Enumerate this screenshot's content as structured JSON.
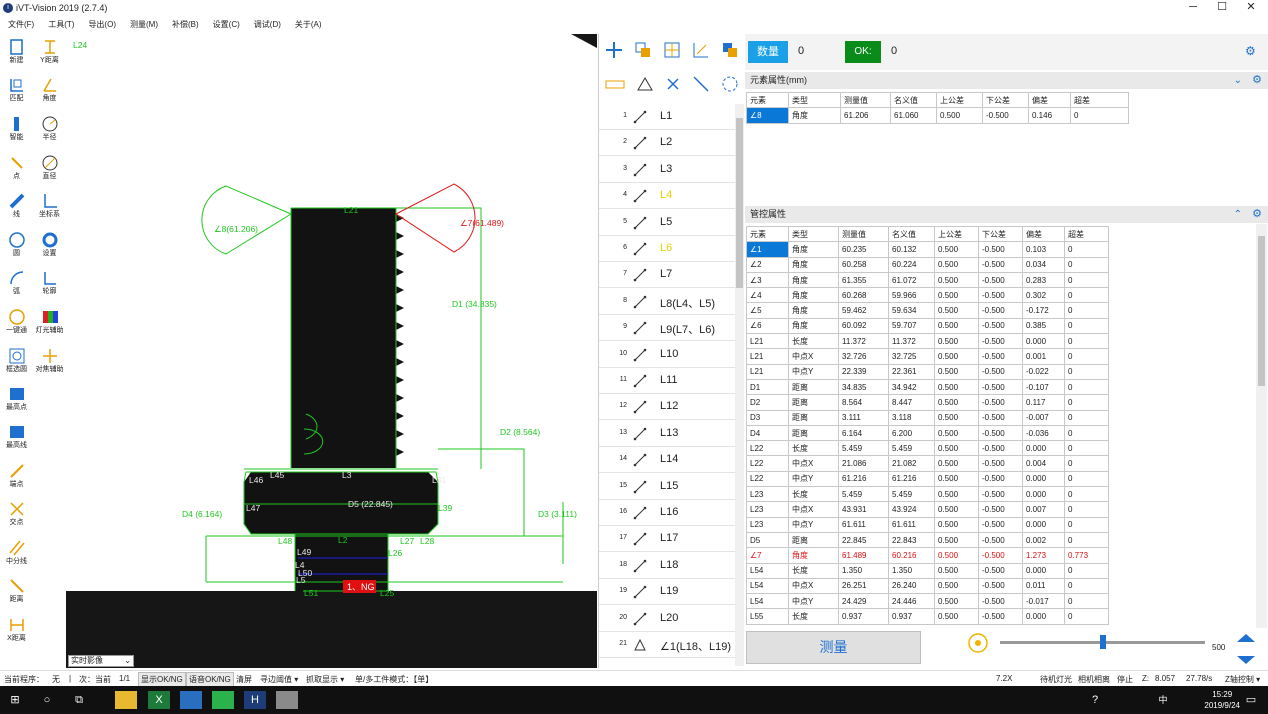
{
  "window": {
    "title": "iVT-Vision 2019  (2.7.4)",
    "minimize": "─",
    "maximize": "☐",
    "close": "✕"
  },
  "menu": [
    "文件(F)",
    "工具(T)",
    "导出(O)",
    "测量(M)",
    "补偿(B)",
    "设置(C)",
    "调试(D)",
    "关于(A)"
  ],
  "lefttools": [
    "新建",
    "Y距离",
    "匹配",
    "角度",
    "智能",
    "半径",
    "点",
    "直径",
    "线",
    "坐标系",
    "圆",
    "设置",
    "弧",
    "轮廓",
    "一键通",
    "灯光辅助",
    "框选圆",
    "对焦辅助",
    "最高点",
    "最高线",
    "端点",
    "交点",
    "中分线",
    "距离",
    "X距离"
  ],
  "viewer": {
    "corner_label": "L24",
    "view_mode": "实时影像",
    "ng_tag": "1、NG",
    "labels": {
      "a8": "∠8(61.206)",
      "a7": "∠7(61.489)",
      "d1": "D1  (34.835)",
      "d2": "D2  (8.564)",
      "d3": "D3  (3.111)",
      "d4": "D4  (6.164)",
      "d5": "D5  (22.845)",
      "l21": "L21",
      "l3": "L3",
      "l2": "L2",
      "l46": "L46",
      "l45": "L45",
      "l47": "L47",
      "l48": "L48",
      "l49": "L49",
      "l51": "L51",
      "l25": "L25",
      "l26": "L26",
      "l27": "L27",
      "l28": "L28",
      "l4": "L4",
      "l5": "L5",
      "l50": "L50",
      "l31": "L31",
      "l39": "L39"
    }
  },
  "midlist": {
    "items": [
      {
        "n": "1",
        "label": "L1"
      },
      {
        "n": "2",
        "label": "L2"
      },
      {
        "n": "3",
        "label": "L3"
      },
      {
        "n": "4",
        "label": "L4"
      },
      {
        "n": "5",
        "label": "L5"
      },
      {
        "n": "6",
        "label": "L6"
      },
      {
        "n": "7",
        "label": "L7"
      },
      {
        "n": "8",
        "label": "L8(L4、L5)"
      },
      {
        "n": "9",
        "label": "L9(L7、L6)"
      },
      {
        "n": "10",
        "label": "L10"
      },
      {
        "n": "11",
        "label": "L11"
      },
      {
        "n": "12",
        "label": "L12"
      },
      {
        "n": "13",
        "label": "L13"
      },
      {
        "n": "14",
        "label": "L14"
      },
      {
        "n": "15",
        "label": "L15"
      },
      {
        "n": "16",
        "label": "L16"
      },
      {
        "n": "17",
        "label": "L17"
      },
      {
        "n": "18",
        "label": "L18"
      },
      {
        "n": "19",
        "label": "L19"
      },
      {
        "n": "20",
        "label": "L20"
      },
      {
        "n": "21",
        "label": "∠1(L18、L19)"
      }
    ]
  },
  "right": {
    "count_label": "数量",
    "count_value": "0",
    "ok_label": "OK:",
    "ok_value": "0",
    "element_section": "元素属性(mm)",
    "control_section": "管控属性",
    "headers": [
      "元素",
      "类型",
      "测量值",
      "名义值",
      "上公差",
      "下公差",
      "偏差",
      "超差"
    ],
    "element_row": [
      "∠8",
      "角度",
      "61.206",
      "61.060",
      "0.500",
      "-0.500",
      "0.146",
      "0"
    ],
    "rows": [
      [
        "∠1",
        "角度",
        "60.235",
        "60.132",
        "0.500",
        "-0.500",
        "0.103",
        "0"
      ],
      [
        "∠2",
        "角度",
        "60.258",
        "60.224",
        "0.500",
        "-0.500",
        "0.034",
        "0"
      ],
      [
        "∠3",
        "角度",
        "61.355",
        "61.072",
        "0.500",
        "-0.500",
        "0.283",
        "0"
      ],
      [
        "∠4",
        "角度",
        "60.268",
        "59.966",
        "0.500",
        "-0.500",
        "0.302",
        "0"
      ],
      [
        "∠5",
        "角度",
        "59.462",
        "59.634",
        "0.500",
        "-0.500",
        "-0.172",
        "0"
      ],
      [
        "∠6",
        "角度",
        "60.092",
        "59.707",
        "0.500",
        "-0.500",
        "0.385",
        "0"
      ],
      [
        "L21",
        "长度",
        "11.372",
        "11.372",
        "0.500",
        "-0.500",
        "0.000",
        "0"
      ],
      [
        "L21",
        "中点X",
        "32.726",
        "32.725",
        "0.500",
        "-0.500",
        "0.001",
        "0"
      ],
      [
        "L21",
        "中点Y",
        "22.339",
        "22.361",
        "0.500",
        "-0.500",
        "-0.022",
        "0"
      ],
      [
        "D1",
        "距离",
        "34.835",
        "34.942",
        "0.500",
        "-0.500",
        "-0.107",
        "0"
      ],
      [
        "D2",
        "距离",
        "8.564",
        "8.447",
        "0.500",
        "-0.500",
        "0.117",
        "0"
      ],
      [
        "D3",
        "距离",
        "3.111",
        "3.118",
        "0.500",
        "-0.500",
        "-0.007",
        "0"
      ],
      [
        "D4",
        "距离",
        "6.164",
        "6.200",
        "0.500",
        "-0.500",
        "-0.036",
        "0"
      ],
      [
        "L22",
        "长度",
        "5.459",
        "5.459",
        "0.500",
        "-0.500",
        "0.000",
        "0"
      ],
      [
        "L22",
        "中点X",
        "21.086",
        "21.082",
        "0.500",
        "-0.500",
        "0.004",
        "0"
      ],
      [
        "L22",
        "中点Y",
        "61.216",
        "61.216",
        "0.500",
        "-0.500",
        "0.000",
        "0"
      ],
      [
        "L23",
        "长度",
        "5.459",
        "5.459",
        "0.500",
        "-0.500",
        "0.000",
        "0"
      ],
      [
        "L23",
        "中点X",
        "43.931",
        "43.924",
        "0.500",
        "-0.500",
        "0.007",
        "0"
      ],
      [
        "L23",
        "中点Y",
        "61.611",
        "61.611",
        "0.500",
        "-0.500",
        "0.000",
        "0"
      ],
      [
        "D5",
        "距离",
        "22.845",
        "22.843",
        "0.500",
        "-0.500",
        "0.002",
        "0"
      ],
      [
        "∠7",
        "角度",
        "61.489",
        "60.216",
        "0.500",
        "-0.500",
        "1.273",
        "0.773"
      ],
      [
        "L54",
        "长度",
        "1.350",
        "1.350",
        "0.500",
        "-0.500",
        "0.000",
        "0"
      ],
      [
        "L54",
        "中点X",
        "26.251",
        "26.240",
        "0.500",
        "-0.500",
        "0.011",
        "0"
      ],
      [
        "L54",
        "中点Y",
        "24.429",
        "24.446",
        "0.500",
        "-0.500",
        "-0.017",
        "0"
      ],
      [
        "L55",
        "长度",
        "0.937",
        "0.937",
        "0.500",
        "-0.500",
        "0.000",
        "0"
      ]
    ],
    "measure_button": "测量",
    "slider_max": "500"
  },
  "status": {
    "program": "当前程序：",
    "program_val": "无",
    "sep": "|",
    "next": "次：当前",
    "page": "1/1",
    "show_okng": "显示OK/NG",
    "voice_okng": "语音OK/NG",
    "clear": "清屏",
    "edge": "寻边阈值 ▾",
    "grab": "抓取显示 ▾",
    "mode": "单/多工件模式：【单】",
    "zoom": "7.2X",
    "light": "待机灯光",
    "camera": "相机相离",
    "stop": "停止",
    "z_label": "Z:",
    "z_val": "8.057",
    "fps": "27.78/s",
    "axis": "Z轴控制 ▾"
  },
  "taskbar": {
    "time": "15:29",
    "date": "2019/9/24",
    "ime": "中"
  }
}
